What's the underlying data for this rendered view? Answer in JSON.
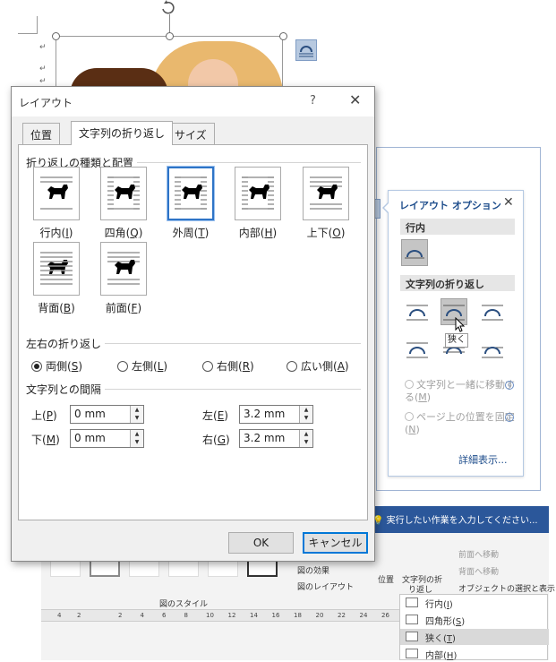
{
  "dialog": {
    "title": "レイアウト",
    "help": "?",
    "close": "✕",
    "tabs": [
      "位置",
      "文字列の折り返し",
      "サイズ"
    ],
    "active_tab": "文字列の折り返し",
    "wrap_section": "折り返しの種類と配置",
    "wrap_options": [
      {
        "label": "行内",
        "key": "I"
      },
      {
        "label": "四角",
        "key": "Q"
      },
      {
        "label": "外周",
        "key": "T",
        "selected": true
      },
      {
        "label": "内部",
        "key": "H"
      },
      {
        "label": "上下",
        "key": "O"
      },
      {
        "label": "背面",
        "key": "B"
      },
      {
        "label": "前面",
        "key": "F"
      }
    ],
    "side_section": "左右の折り返し",
    "side_options": [
      {
        "label": "両側",
        "key": "S",
        "checked": true
      },
      {
        "label": "左側",
        "key": "L"
      },
      {
        "label": "右側",
        "key": "R"
      },
      {
        "label": "広い側",
        "key": "A"
      }
    ],
    "spacing_section": "文字列との間隔",
    "spacing": [
      {
        "label": "上",
        "key": "P",
        "value": "0 mm"
      },
      {
        "label": "下",
        "key": "M",
        "value": "0 mm"
      },
      {
        "label": "左",
        "key": "E",
        "value": "3.2 mm"
      },
      {
        "label": "右",
        "key": "G",
        "value": "3.2 mm"
      }
    ],
    "ok": "OK",
    "cancel": "キャンセル"
  },
  "layout_options": {
    "title": "レイアウト オプション",
    "close": "✕",
    "inline_section": "行内",
    "wrap_section": "文字列の折り返し",
    "tooltip": "狭く",
    "move_with_text": "文字列と一緒に移動する",
    "move_with_text_key": "M",
    "fix_position": "ページ上の位置を固定",
    "fix_position_key": "N",
    "more": "詳細表示..."
  },
  "ribbon": {
    "tell_me": "実行したい作業を入力してください...",
    "picture_effects": "図の効果",
    "picture_layout": "図のレイアウト",
    "styles_group": "図のスタイル",
    "position": "位置",
    "wrap_text_1": "文字列の折",
    "wrap_text_2": "り返し",
    "bring_forward": "前面へ移動",
    "send_backward": "背面へ移動",
    "selection_pane": "オブジェクトの選択と表示",
    "ruler_labels": [
      "4",
      "2",
      "2",
      "4",
      "6",
      "8",
      "10",
      "12",
      "14",
      "16",
      "18",
      "20",
      "22",
      "24",
      "26",
      "28",
      "30"
    ]
  },
  "wrap_menu": [
    {
      "label": "行内",
      "key": "I"
    },
    {
      "label": "四角形",
      "key": "S"
    },
    {
      "label": "狭く",
      "key": "T",
      "highlighted": true
    },
    {
      "label": "内部",
      "key": "H"
    }
  ],
  "colors": {
    "accent": "#2e74c7",
    "ribbon_blue": "#2b579a",
    "link": "#1f4e8c"
  }
}
